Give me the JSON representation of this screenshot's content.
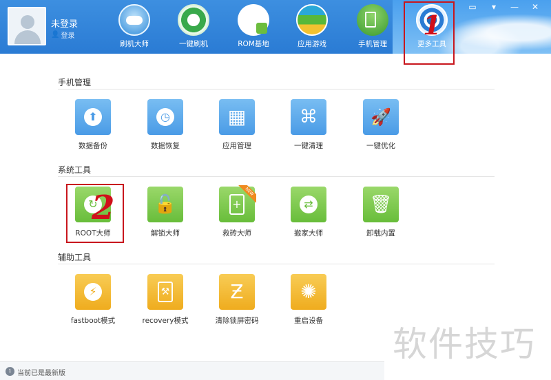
{
  "user": {
    "name": "未登录",
    "login_label": "登录"
  },
  "nav": [
    {
      "label": "刷机大师",
      "icon": "cloud-icon"
    },
    {
      "label": "一键刷机",
      "icon": "refresh-icon"
    },
    {
      "label": "ROM基地",
      "icon": "shopping-bag-icon"
    },
    {
      "label": "应用游戏",
      "icon": "apps-icon"
    },
    {
      "label": "手机管理",
      "icon": "phone-shield-icon"
    },
    {
      "label": "更多工具",
      "icon": "gear-icon"
    }
  ],
  "sections": [
    {
      "title": "手机管理",
      "items": [
        {
          "label": "数据备份",
          "icon": "cloud-upload-icon"
        },
        {
          "label": "数据恢复",
          "icon": "clock-icon"
        },
        {
          "label": "应用管理",
          "icon": "grid-icon"
        },
        {
          "label": "一键清理",
          "icon": "brush-icon"
        },
        {
          "label": "一键优化",
          "icon": "rocket-icon"
        }
      ]
    },
    {
      "title": "系统工具",
      "items": [
        {
          "label": "ROOT大师",
          "icon": "root-icon"
        },
        {
          "label": "解锁大师",
          "icon": "unlock-icon"
        },
        {
          "label": "救砖大师",
          "icon": "phone-plus-icon",
          "badge": "NEW"
        },
        {
          "label": "搬家大师",
          "icon": "transfer-icon"
        },
        {
          "label": "卸载内置",
          "icon": "trash-icon"
        }
      ]
    },
    {
      "title": "辅助工具",
      "items": [
        {
          "label": "fastboot模式",
          "icon": "lightning-icon"
        },
        {
          "label": "recovery模式",
          "icon": "phone-wrench-icon"
        },
        {
          "label": "清除锁屏密码",
          "icon": "unlock-pattern-icon"
        },
        {
          "label": "重启设备",
          "icon": "spinner-icon"
        }
      ]
    }
  ],
  "status": {
    "text": "当前已是最新版"
  },
  "annotations": [
    "1",
    "2"
  ],
  "watermark": "软件技巧",
  "colors": {
    "header": "#2a7bd4",
    "tile_blue": "#4a9be6",
    "tile_green": "#68bd3a",
    "tile_orange": "#efac1e",
    "annotation": "#c8161d"
  }
}
